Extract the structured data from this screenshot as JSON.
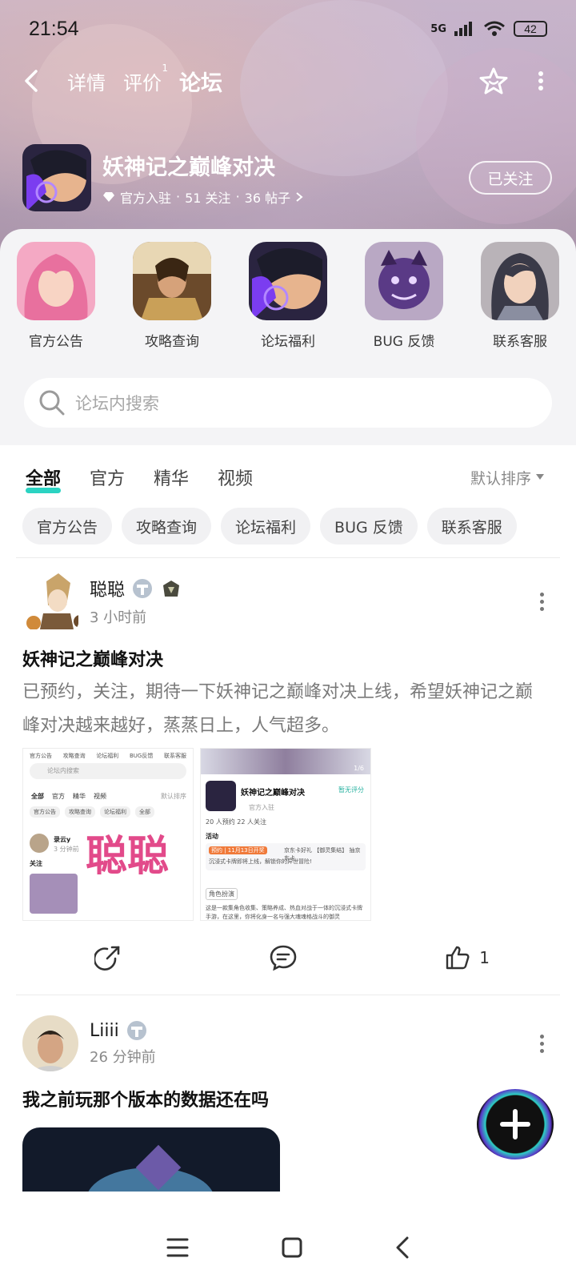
{
  "status": {
    "time": "21:54",
    "network": "5G",
    "battery": "42"
  },
  "nav": {
    "tabs": [
      {
        "label": "详情",
        "badge": ""
      },
      {
        "label": "评价",
        "badge": "1"
      },
      {
        "label": "论坛",
        "badge": ""
      }
    ],
    "active_tab": "论坛"
  },
  "game": {
    "title": "妖神记之巅峰对决",
    "official_badge": "官方入驻",
    "follows": "51 关注",
    "posts": "36 帖子",
    "follow_button": "已关注"
  },
  "categories": [
    {
      "label": "官方公告",
      "icon": "pink-hair-character"
    },
    {
      "label": "攻略查询",
      "icon": "warrior-character"
    },
    {
      "label": "论坛福利",
      "icon": "game-logo"
    },
    {
      "label": "BUG 反馈",
      "icon": "purple-beast"
    },
    {
      "label": "联系客服",
      "icon": "girl-character"
    }
  ],
  "search": {
    "placeholder": "论坛内搜索"
  },
  "filter_tabs": [
    "全部",
    "官方",
    "精华",
    "视频"
  ],
  "sort_label": "默认排序",
  "chips": [
    "官方公告",
    "攻略查询",
    "论坛福利",
    "BUG 反馈",
    "联系客服"
  ],
  "posts": [
    {
      "author": "聪聪",
      "time": "3 小时前",
      "title": "妖神记之巅峰对决",
      "body": "已预约，关注，期待一下妖神记之巅峰对决上线，希望妖神记之巅峰对决越来越好，蒸蒸日上，人气超多。",
      "likes": "1",
      "shot1": {
        "tabs": [
          "官方公告",
          "攻略查询",
          "论坛福利",
          "BUG反馈",
          "联系客服"
        ],
        "search": "论坛内搜索",
        "filters": [
          "全部",
          "官方",
          "精华",
          "视频"
        ],
        "sort": "默认排序",
        "chips": [
          "官方公告",
          "攻略查询",
          "论坛福利",
          "全部"
        ],
        "user": "录云y",
        "user_time": "3 分钟前",
        "follow": "关注",
        "watermark": "聪聪"
      },
      "shot2": {
        "counter": "1/6",
        "title": "妖神记之巅峰对决",
        "action": "暂无评分",
        "official": "官方入驻",
        "stats": "20 人预约   22 人关注",
        "event_label": "活动",
        "event_tag": "预约 | 11月13日开奖",
        "event_text": "京东卡好礼 【御灵集结】 抽京东卡",
        "event_text2": "沉浸式卡牌即将上线，解锁你的异世冒险!",
        "section": "角色扮演",
        "desc": "这是一款集角色收集、策略养成、热血对战于一体的沉浸式卡牌手游，在这里，你将化身一名与强大魂魂格战斗的御灵"
      }
    },
    {
      "author": "Liiii",
      "time": "26 分钟前",
      "title": "我之前玩那个版本的数据还在吗"
    }
  ],
  "colors": {
    "accent": "#2bd3c2",
    "header_bg": "#b9a3b8"
  }
}
